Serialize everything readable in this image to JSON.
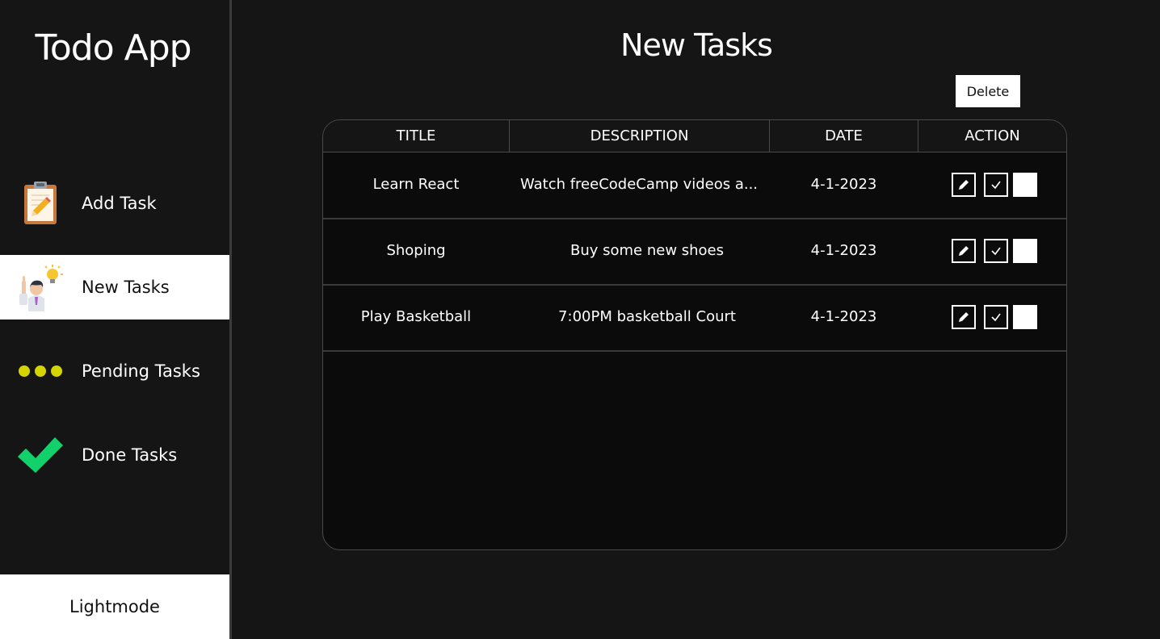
{
  "app": {
    "title": "Todo App"
  },
  "sidebar": {
    "items": [
      {
        "label": "Add Task",
        "icon": "clipboard-pencil-icon",
        "active": false
      },
      {
        "label": "New Tasks",
        "icon": "idea-person-icon",
        "active": true
      },
      {
        "label": "Pending Tasks",
        "icon": "three-dots-icon",
        "active": false
      },
      {
        "label": "Done Tasks",
        "icon": "checkmark-icon",
        "active": false
      }
    ],
    "mode_toggle_label": "Lightmode"
  },
  "main": {
    "page_title": "New Tasks",
    "delete_label": "Delete",
    "table": {
      "headers": [
        "TITLE",
        "DESCRIPTION",
        "DATE",
        "ACTION"
      ],
      "rows": [
        {
          "title": "Learn React",
          "description": "Watch freeCodeCamp videos a...",
          "date": "4-1-2023"
        },
        {
          "title": "Shoping",
          "description": "Buy some new shoes",
          "date": "4-1-2023"
        },
        {
          "title": "Play Basketball",
          "description": "7:00PM basketball Court",
          "date": "4-1-2023"
        }
      ],
      "action_icons": [
        "pencil-icon",
        "check-icon",
        "blank-checkbox"
      ]
    }
  },
  "colors": {
    "background": "#151515",
    "table_background": "#0b0b0b",
    "active_item": "#ffffff",
    "done_green": "#13d16a",
    "pending_yellow": "#d4d400"
  }
}
